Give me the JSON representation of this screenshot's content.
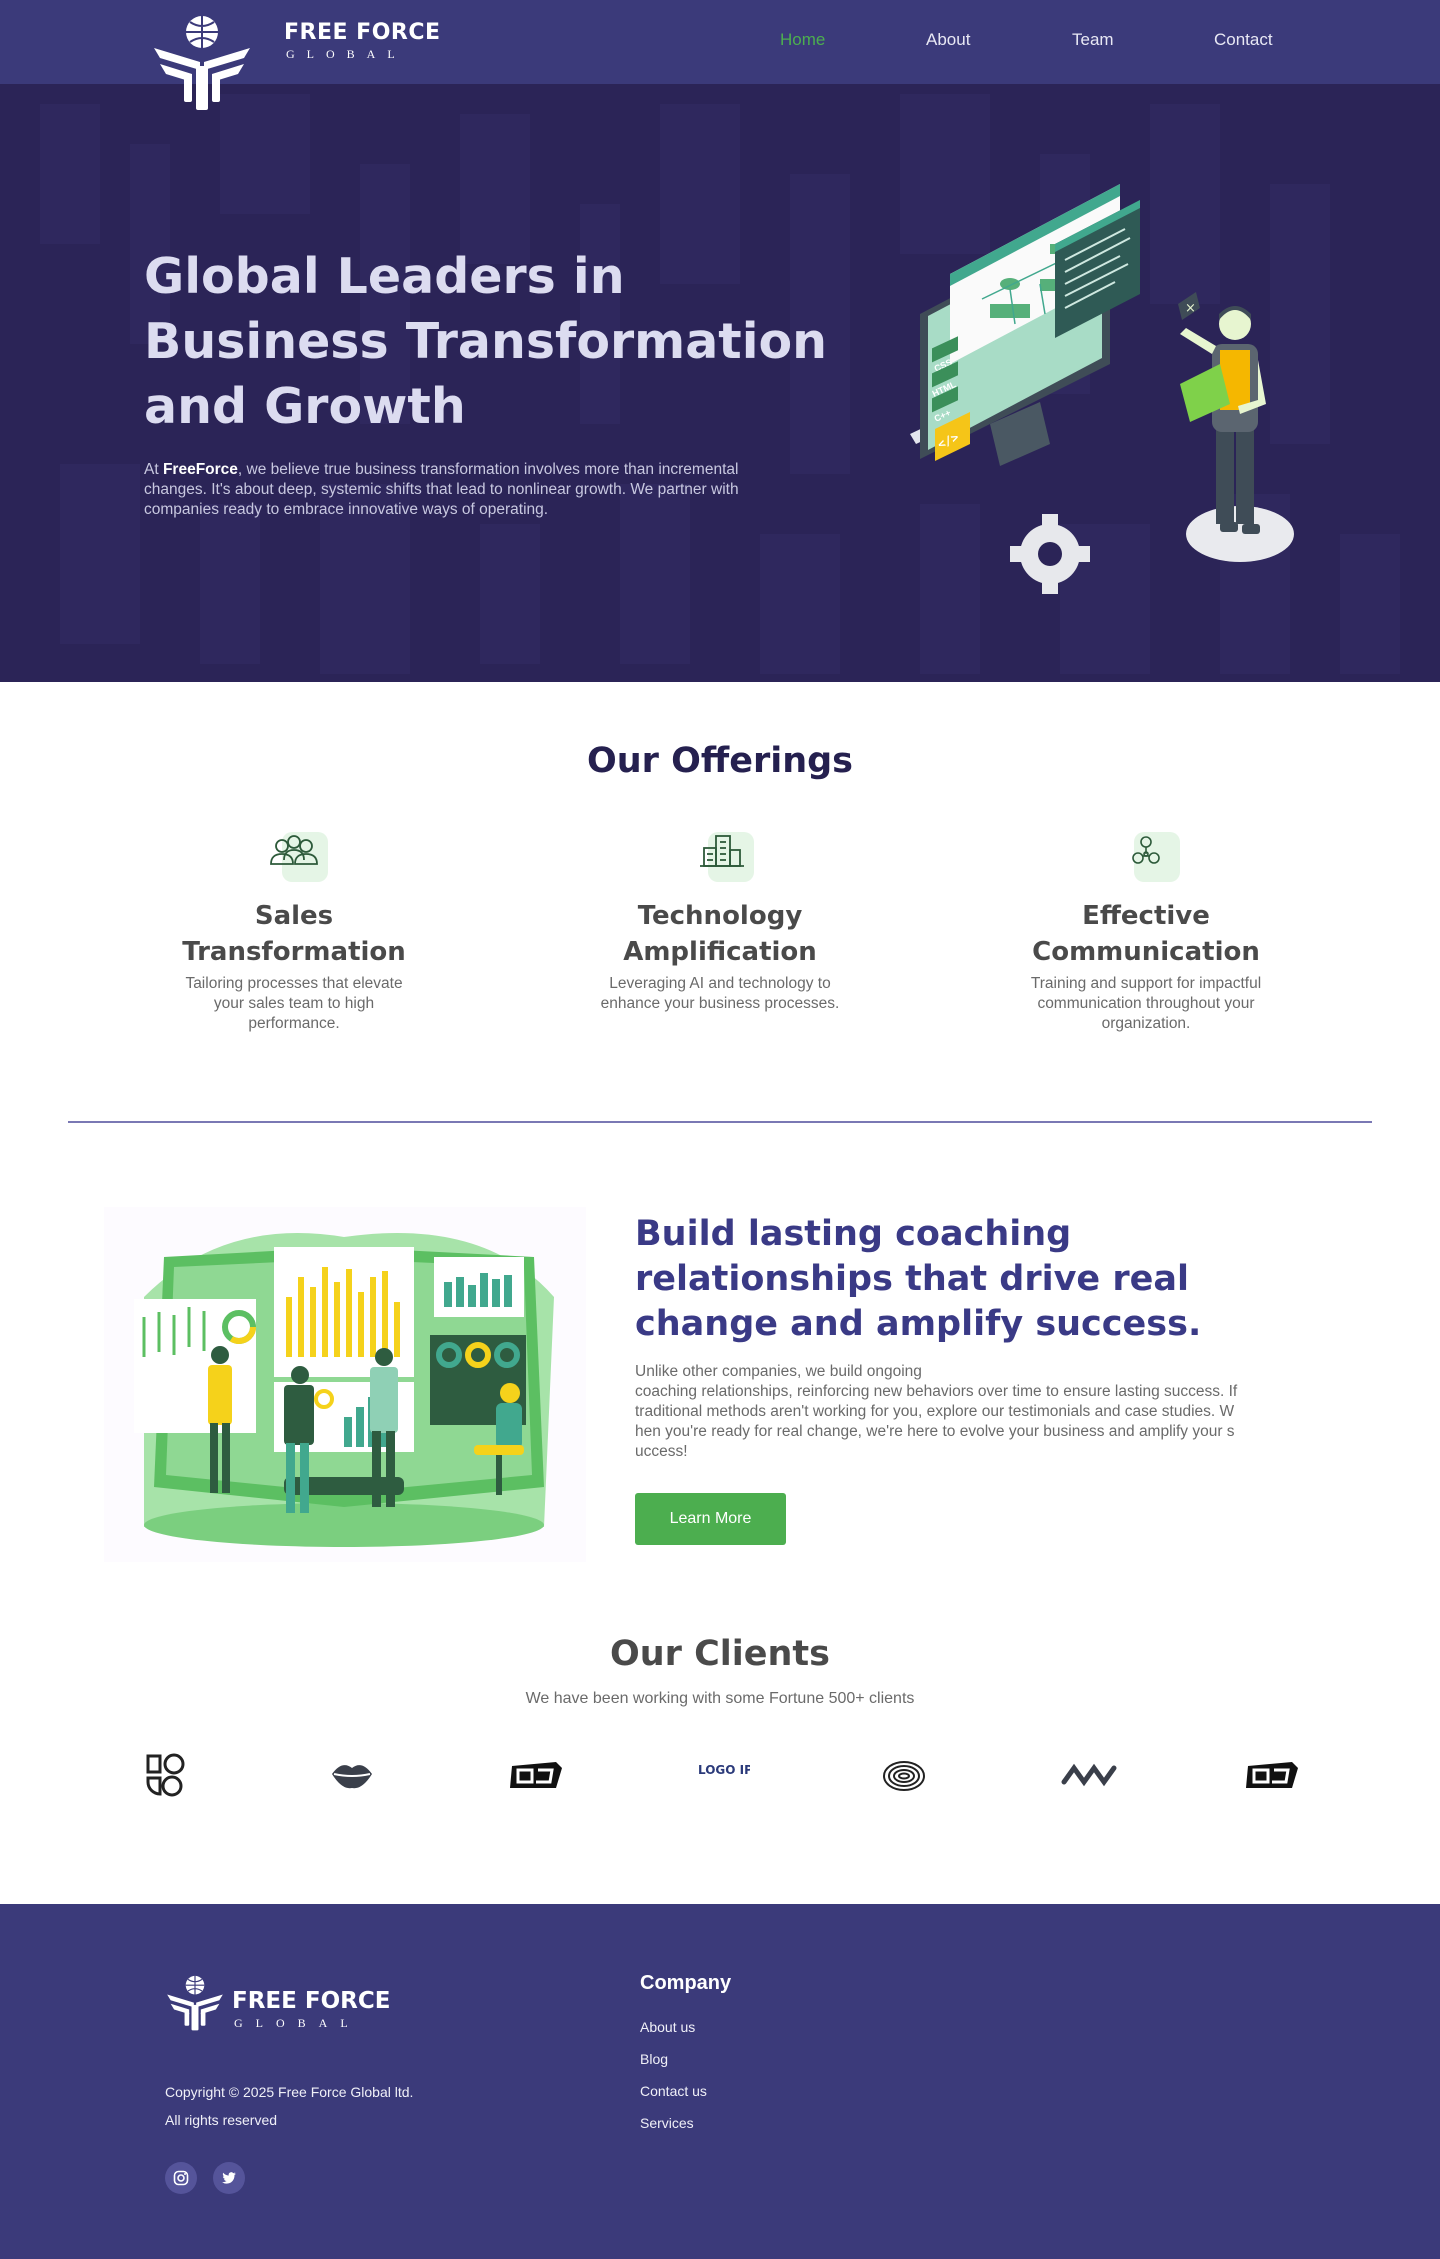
{
  "brand": {
    "name": "FREE FORCE",
    "tagline": "GLOBAL",
    "colors": {
      "primary": "#3b3a7a",
      "hero": "#2b2457",
      "accent": "#4cae4f",
      "heading": "#25204f"
    }
  },
  "nav": {
    "links": [
      {
        "label": "Home",
        "active": true
      },
      {
        "label": "About",
        "active": false
      },
      {
        "label": "Team",
        "active": false
      },
      {
        "label": "Contact",
        "active": false
      }
    ]
  },
  "hero": {
    "title_line1": "Global Leaders in",
    "title_line2": "Business Transformation",
    "title_line3": "and Growth",
    "text_prefix": "At ",
    "text_brand": "FreeForce",
    "text_rest": ", we believe true business transformation involves more than incremental changes. It's about deep, systemic shifts that lead to nonlinear growth. We partner with companies ready to embrace innovative ways of operating.",
    "art_labels": {
      "css": "CSS",
      "html": "HTML",
      "cpp": "C++",
      "code": "</>"
    }
  },
  "offerings": {
    "title": "Our Offerings",
    "items": [
      {
        "title_line1": "Sales",
        "title_line2": "Transformation",
        "description": "Tailoring processes that elevate your sales team to high performance.",
        "icon": "users-icon"
      },
      {
        "title_line1": "Technology",
        "title_line2": "Amplification",
        "description": "Leveraging AI and technology to enhance your business processes.",
        "icon": "buildings-icon"
      },
      {
        "title_line1": "Effective",
        "title_line2": "Communication",
        "description": "Training and support for impactful communication throughout your organization.",
        "icon": "network-icon"
      }
    ]
  },
  "coaching": {
    "title": "Build lasting coaching relationships that drive real change and amplify success.",
    "text_line1": "Unlike other companies, we build ongoing",
    "text_rest": "coaching relationships, reinforcing new behaviors over time to ensure lasting success. If traditional methods aren't working for you, explore our testimonials and case studies. When you're ready for real change, we're here to evolve your business and amplify your success!",
    "button_label": "Learn More"
  },
  "clients": {
    "title": "Our Clients",
    "subtitle": "We have been working with some Fortune 500+ clients",
    "logo_wordmark": "LOGO IPSUM",
    "logos": [
      "shapes-logo-icon",
      "lips-logo-icon",
      "oj-logo-icon",
      "logoipsum-logo-icon",
      "fingerprint-logo-icon",
      "chain-logo-icon",
      "oj-logo-icon"
    ]
  },
  "footer": {
    "brand_name": "FREE FORCE",
    "brand_tagline": "GLOBAL",
    "copyright": "Copyright © 2025 Free Force Global ltd.",
    "rights": "All rights reserved",
    "company_title": "Company",
    "links": [
      "About us",
      "Blog",
      "Contact us",
      "Services"
    ],
    "social": [
      "instagram-icon",
      "twitter-icon"
    ]
  }
}
